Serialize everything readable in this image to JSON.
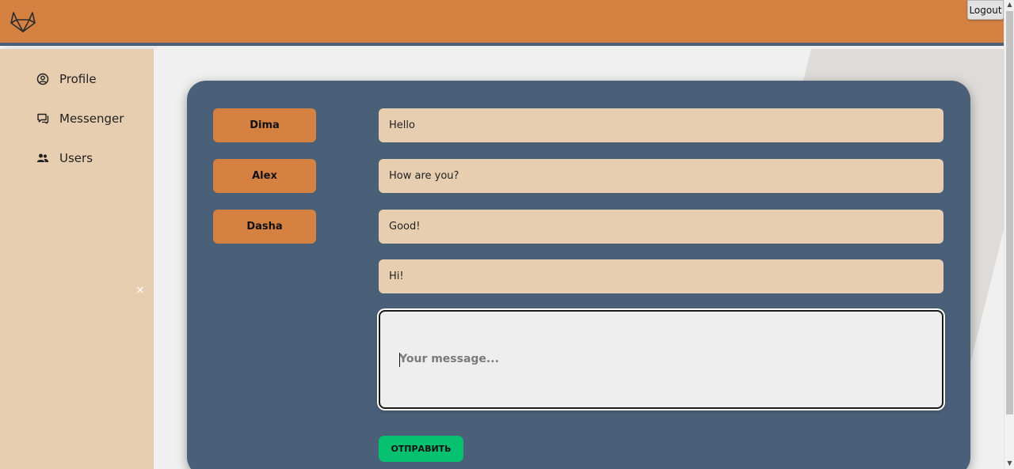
{
  "header": {
    "logo_icon": "gitlab-fox-logo",
    "logout_label": "Logout"
  },
  "sidebar": {
    "items": [
      {
        "label": "Profile",
        "icon": "user-circle-icon"
      },
      {
        "label": "Messenger",
        "icon": "chat-bubble-icon"
      },
      {
        "label": "Users",
        "icon": "users-icon"
      }
    ],
    "close_label": "×"
  },
  "chat": {
    "dialogs": [
      {
        "name": "Dima"
      },
      {
        "name": "Alex"
      },
      {
        "name": "Dasha"
      }
    ],
    "messages": [
      {
        "text": "Hello"
      },
      {
        "text": "How are you?"
      },
      {
        "text": "Good!"
      },
      {
        "text": "Hi!"
      }
    ],
    "composer": {
      "placeholder": "Your message...",
      "value": ""
    },
    "send_label": "ОТПРАВИТЬ"
  },
  "colors": {
    "header": "#d48142",
    "sidebar": "#e7ceb0",
    "card": "#4a5f78",
    "dialog_button": "#d48142",
    "message": "#e7ceb0",
    "send_button": "#06c16f"
  }
}
